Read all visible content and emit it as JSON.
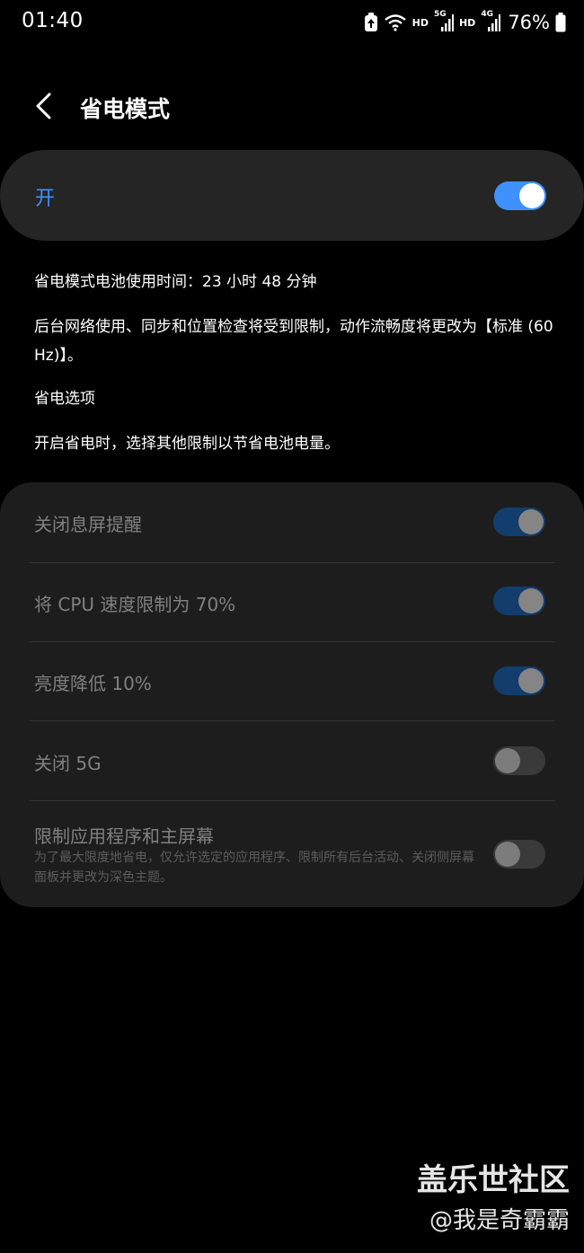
{
  "status_bar": {
    "time": "01:40",
    "hd1": "HD",
    "net1": "5G",
    "hd2": "HD",
    "net2": "4G",
    "battery": "76%"
  },
  "header": {
    "title": "省电模式"
  },
  "master": {
    "label": "开",
    "enabled": true
  },
  "info": {
    "usage_time": "省电模式电池使用时间：23 小时 48 分钟",
    "restrictions": "后台网络使用、同步和位置检查将受到限制，动作流畅度将更改为【标准 (60 Hz)】。",
    "options_heading": "省电选项",
    "options_desc": "开启省电时，选择其他限制以节省电池电量。"
  },
  "options": [
    {
      "label": "关闭息屏提醒",
      "on": true
    },
    {
      "label": "将 CPU 速度限制为 70%",
      "on": true
    },
    {
      "label": "亮度降低 10%",
      "on": true
    },
    {
      "label": "关闭 5G",
      "on": false
    },
    {
      "label": "限制应用程序和主屏幕",
      "sub": "为了最大限度地省电，仅允许选定的应用程序、限制所有后台活动、关闭侧屏幕面板并更改为深色主题。",
      "on": false
    }
  ],
  "watermark": {
    "site": "盖乐世社区",
    "user": "@我是奇霸霸"
  },
  "colors": {
    "accent": "#3e91ff",
    "background": "#000000",
    "card": "#252525"
  }
}
